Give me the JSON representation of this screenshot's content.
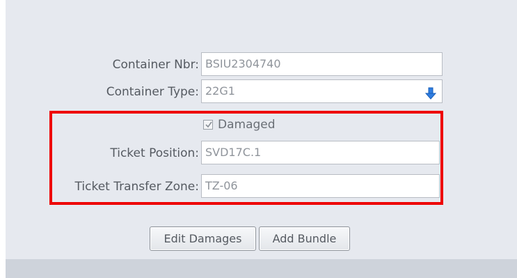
{
  "form": {
    "container_nbr": {
      "label": "Container Nbr:",
      "value": "BSIU2304740"
    },
    "container_type": {
      "label": "Container Type:",
      "value": "22G1"
    },
    "damaged": {
      "label": "Damaged",
      "checked": true
    },
    "ticket_position": {
      "label": "Ticket Position:",
      "value": "SVD17C.1"
    },
    "ticket_transfer_zone": {
      "label": "Ticket Transfer Zone:",
      "value": "TZ-06"
    }
  },
  "buttons": {
    "edit_damages": "Edit Damages",
    "add_bundle": "Add Bundle"
  },
  "colors": {
    "highlight": "#ee0000",
    "dropdown_arrow": "#2f7de1"
  },
  "icons": {
    "dropdown": "arrow-down-icon",
    "checkbox": "checkmark-icon"
  }
}
